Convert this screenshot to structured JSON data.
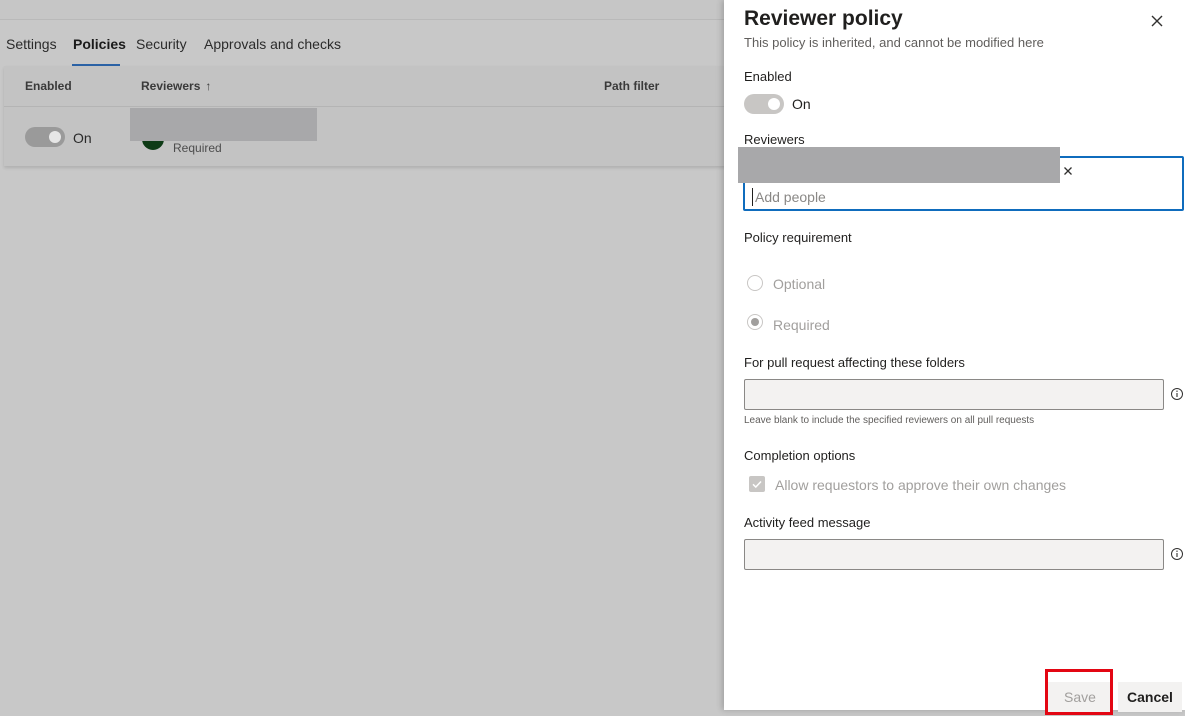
{
  "background": {
    "tabs": [
      {
        "label": "Settings"
      },
      {
        "label": "Policies"
      },
      {
        "label": "Security"
      },
      {
        "label": "Approvals and checks"
      }
    ],
    "table": {
      "headers": {
        "enabled": "Enabled",
        "reviewers": "Reviewers",
        "sort_icon": "arrow-up-icon",
        "path_filter": "Path filter"
      },
      "row": {
        "toggle_text": "On",
        "requirement": "Required",
        "avatar_color": "#0e3b16"
      }
    }
  },
  "panel": {
    "title": "Reviewer policy",
    "subtitle": "This policy is inherited, and cannot be modified here",
    "close_icon": "close-icon",
    "enabled_label": "Enabled",
    "enabled_value": "On",
    "reviewers_label": "Reviewers",
    "reviewers_placeholder": "Add people",
    "requirement_label": "Policy requirement",
    "requirement_options": [
      {
        "label": "Optional",
        "selected": false
      },
      {
        "label": "Required",
        "selected": true
      }
    ],
    "folders_label": "For pull request affecting these folders",
    "folders_value": "",
    "folders_helper": "Leave blank to include the specified reviewers on all pull requests",
    "completion_label": "Completion options",
    "completion_option": "Allow requestors to approve their own changes",
    "completion_checked": true,
    "activity_label": "Activity feed message",
    "activity_value": "",
    "save_label": "Save",
    "cancel_label": "Cancel",
    "accent_color": "#0f6cbd",
    "highlight_color": "#e30613"
  }
}
